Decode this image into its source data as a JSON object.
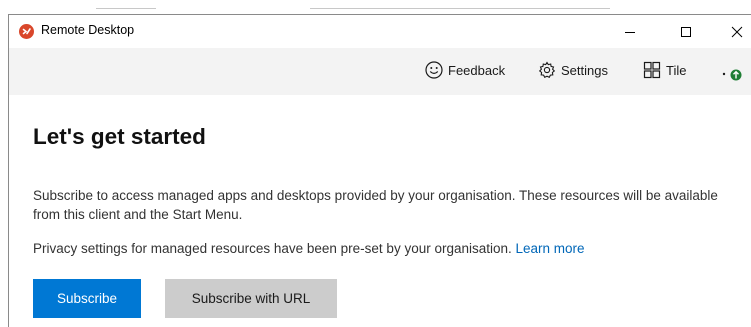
{
  "window": {
    "title": "Remote Desktop",
    "controls": {
      "minimize": "minimize-icon",
      "maximize": "maximize-icon",
      "close": "close-icon"
    }
  },
  "toolbar": {
    "feedback_label": "Feedback",
    "settings_label": "Settings",
    "tile_label": "Tile",
    "icons": [
      "smiley-icon",
      "gear-icon",
      "tile-grid-icon",
      "more-icon",
      "update-badge-icon"
    ]
  },
  "main": {
    "heading": "Let's get started",
    "description": "Subscribe to access managed apps and desktops provided by your organisation. These resources will be available from this client and the Start Menu.",
    "privacy_text": "Privacy settings for managed resources have been pre-set by your organisation. ",
    "learn_more": "Learn more",
    "subscribe_button": "Subscribe",
    "subscribe_url_button": "Subscribe with URL"
  },
  "colors": {
    "accent": "#0078d4",
    "link": "#0067b8",
    "toolbar_bg": "#f3f3f3",
    "secondary_button": "#cccccc",
    "app_icon": "#d9472b",
    "badge": "#1e7e34"
  }
}
